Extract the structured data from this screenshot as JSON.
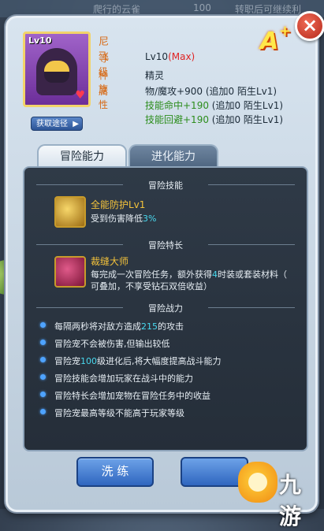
{
  "background": {
    "top_left_text": "爬行的云雀",
    "top_mid_value": "100",
    "top_right_text": "转职后可继续利"
  },
  "close_button": {
    "glyph": "×"
  },
  "rank_badge": {
    "letter": "A",
    "plus": "+"
  },
  "pet": {
    "portrait_level": "Lv10",
    "name": "尼飞",
    "level_label": "等级",
    "level_value": "Lv10",
    "level_max": "(Max)",
    "race_label": "种族",
    "race_value": "精灵",
    "attr_label": "属性",
    "attributes": [
      {
        "main": "物/魔攻+900",
        "extra": " (追加0 陌生Lv1)"
      },
      {
        "main": "技能命中+190",
        "extra": " (追加0 陌生Lv1)"
      },
      {
        "main": "技能回避+190",
        "extra": " (追加0 陌生Lv1)"
      }
    ],
    "obtain_button": "获取途径",
    "obtain_arrow": "▶"
  },
  "tabs": [
    {
      "label": "冒险能力",
      "active": true
    },
    {
      "label": "进化能力",
      "active": false
    }
  ],
  "adventure": {
    "skill_section": "冒险技能",
    "skill": {
      "name": "全能防护Lv1",
      "desc_prefix": "受到伤害降低",
      "desc_value": "3%"
    },
    "specialty_section": "冒险特长",
    "specialty": {
      "name": "裁缝大师",
      "line1_prefix": "每完成一次冒险任务，额外获得",
      "line1_value": "4",
      "line1_suffix": "时装或套装材料（",
      "line2": "可叠加，不享受钻石双倍收益）"
    },
    "combat_section": "冒险战力",
    "combat_items": [
      {
        "prefix": "每隔两秒将对敌方造成",
        "value": "215",
        "suffix": "的攻击"
      },
      {
        "prefix": "冒险宠不会被伤害,但输出较低",
        "value": "",
        "suffix": ""
      },
      {
        "prefix": "冒险宠",
        "value": "100",
        "suffix": "级进化后,将大幅度提高战斗能力"
      },
      {
        "prefix": "冒险技能会增加玩家在战斗中的能力",
        "value": "",
        "suffix": ""
      },
      {
        "prefix": "冒险特长会增加宠物在冒险任务中的收益",
        "value": "",
        "suffix": ""
      },
      {
        "prefix": "冒险宠最高等级不能高于玩家等级",
        "value": "",
        "suffix": ""
      }
    ]
  },
  "buttons": {
    "wash": "洗 练"
  },
  "watermark": {
    "text": "九游"
  }
}
